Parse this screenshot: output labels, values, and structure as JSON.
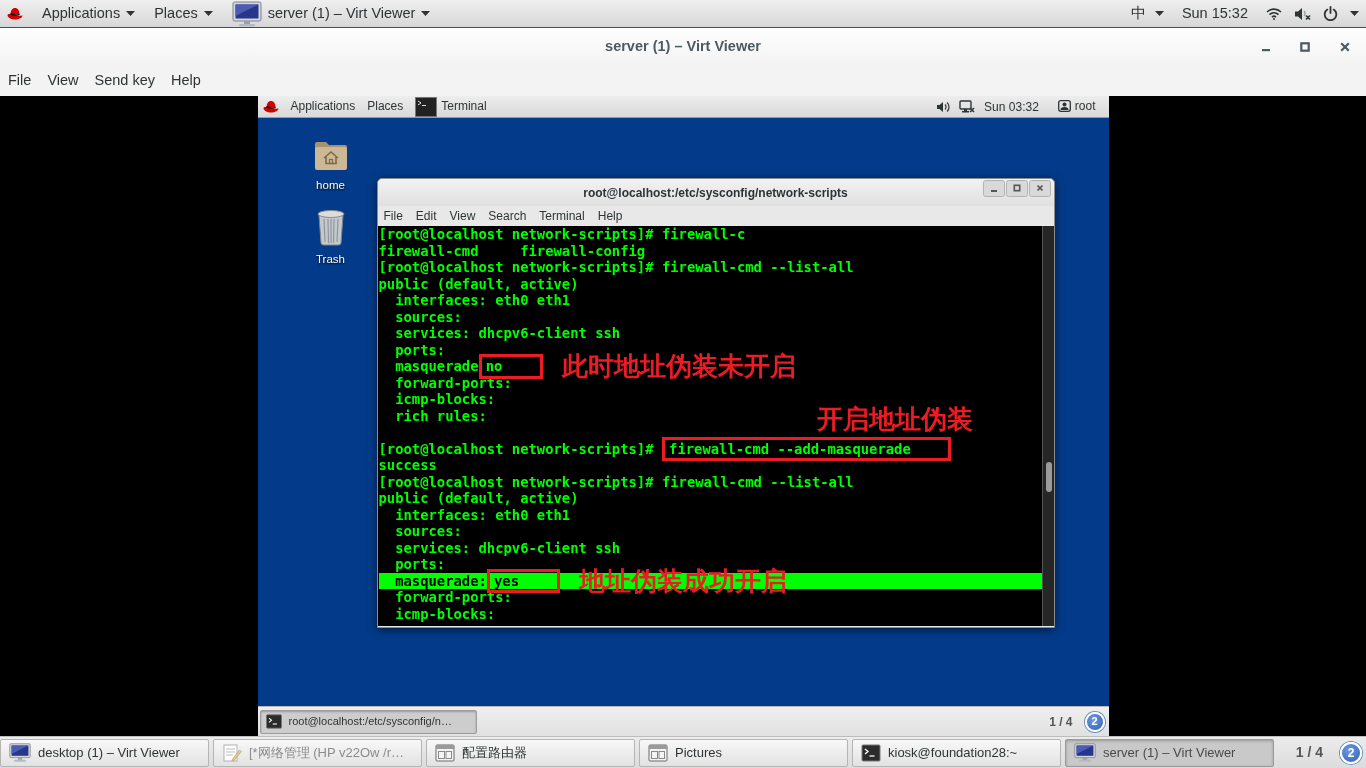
{
  "top_bar": {
    "menus": [
      "Applications",
      "Places"
    ],
    "window_menu": "server (1) – Virt Viewer",
    "input_method": "中",
    "clock": "Sun 15:32"
  },
  "window": {
    "title": "server (1) – Virt Viewer",
    "menu": [
      "File",
      "View",
      "Send key",
      "Help"
    ]
  },
  "guest": {
    "top_bar": {
      "menus": [
        "Applications",
        "Places"
      ],
      "app": "Terminal",
      "clock": "Sun 03:32",
      "user": "root"
    },
    "desktop_icons": [
      {
        "kind": "folder",
        "label": "home"
      },
      {
        "kind": "trash",
        "label": "Trash"
      }
    ],
    "terminal": {
      "title": "root@localhost:/etc/sysconfig/network-scripts",
      "menu": [
        "File",
        "Edit",
        "View",
        "Search",
        "Terminal",
        "Help"
      ],
      "lines": [
        {
          "kind": "plain",
          "text": "[root@localhost network-scripts]# firewall-c",
          "highlighted": false
        },
        {
          "kind": "plain",
          "text": "firewall-cmd     firewall-config",
          "highlighted": false
        },
        {
          "kind": "plain",
          "text": "[root@localhost network-scripts]# firewall-cmd --list-all",
          "highlighted": false
        },
        {
          "kind": "plain",
          "text": "public (default, active)",
          "highlighted": false
        },
        {
          "kind": "plain",
          "text": "  interfaces: eth0 eth1",
          "highlighted": false
        },
        {
          "kind": "plain",
          "text": "  sources:",
          "highlighted": false
        },
        {
          "kind": "plain",
          "text": "  services: dhcpv6-client ssh",
          "highlighted": false
        },
        {
          "kind": "plain",
          "text": "  ports:",
          "highlighted": false
        },
        {
          "kind": "annotated",
          "text": "  masquerade",
          "boxed": "no",
          "note": "此时地址伪装未开启",
          "note_above": false,
          "highlighted": false
        },
        {
          "kind": "plain",
          "text": "  forward-ports:",
          "highlighted": false
        },
        {
          "kind": "plain",
          "text": "  icmp-blocks:",
          "highlighted": false
        },
        {
          "kind": "plain",
          "text": "  rich rules:",
          "highlighted": false
        },
        {
          "kind": "blank",
          "highlighted": false
        },
        {
          "kind": "annotated",
          "text": "[root@localhost network-scripts]# ",
          "boxed": "firewall-cmd --add-masquerade",
          "note": "开启地址伪装",
          "note_above": true,
          "highlighted": false
        },
        {
          "kind": "plain",
          "text": "success",
          "highlighted": false
        },
        {
          "kind": "plain",
          "text": "[root@localhost network-scripts]# firewall-cmd --list-all",
          "highlighted": false
        },
        {
          "kind": "plain",
          "text": "public (default, active)",
          "highlighted": false
        },
        {
          "kind": "plain",
          "text": "  interfaces: eth0 eth1",
          "highlighted": false
        },
        {
          "kind": "plain",
          "text": "  sources:",
          "highlighted": false
        },
        {
          "kind": "plain",
          "text": "  services: dhcpv6-client ssh",
          "highlighted": false
        },
        {
          "kind": "plain",
          "text": "  ports:",
          "highlighted": false
        },
        {
          "kind": "annotated",
          "text": "  masquerade:",
          "boxed": "yes",
          "note": "地址伪装成功开启",
          "note_above": false,
          "highlighted": true
        },
        {
          "kind": "plain",
          "text": "  forward-ports:",
          "highlighted": false
        },
        {
          "kind": "plain",
          "text": "  icmp-blocks:",
          "highlighted": false
        }
      ]
    },
    "window_list": {
      "items": [
        {
          "label": "root@localhost:/etc/sysconfig/n…",
          "selected": true
        }
      ],
      "workspace": "1 / 4",
      "notifications": "2"
    }
  },
  "taskbar": {
    "items": [
      {
        "kind": "monitor",
        "label": "desktop (1) – Virt Viewer",
        "selected": false,
        "minimized": false
      },
      {
        "kind": "editor",
        "label": "[*网络管理 (HP v22Ow /r…",
        "selected": false,
        "minimized": true
      },
      {
        "kind": "window",
        "label": "配置路由器",
        "selected": false,
        "minimized": false
      },
      {
        "kind": "window",
        "label": "Pictures",
        "selected": false,
        "minimized": false
      },
      {
        "kind": "terminal",
        "label": "kiosk@foundation28:~",
        "selected": false,
        "minimized": false
      },
      {
        "kind": "monitor",
        "label": "server (1) – Virt Viewer",
        "selected": true,
        "minimized": false
      }
    ],
    "workspace": "1 / 4",
    "notifications": "2"
  }
}
